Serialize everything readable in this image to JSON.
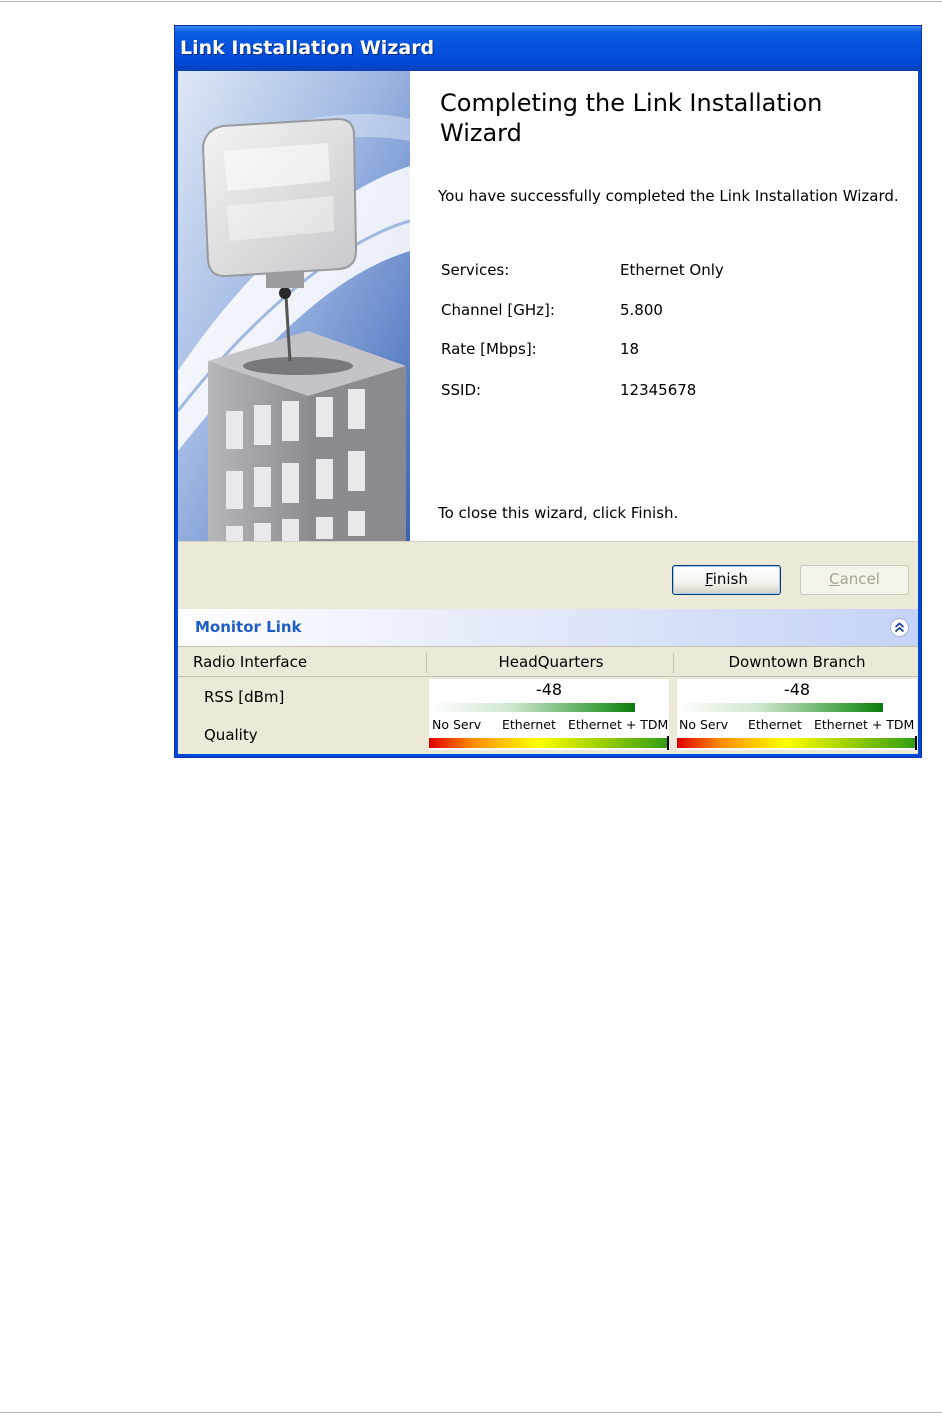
{
  "window": {
    "title": "Link Installation Wizard"
  },
  "content": {
    "heading": "Completing the Link Installation Wizard",
    "message": "You have successfully completed the Link Installation  Wizard.",
    "summary": [
      {
        "label": "Services:",
        "value": "Ethernet Only"
      },
      {
        "label": "Channel [GHz]:",
        "value": "5.800"
      },
      {
        "label": "Rate [Mbps]:",
        "value": "18"
      },
      {
        "label": "SSID:",
        "value": "12345678"
      }
    ],
    "closing": "To close this wizard, click Finish."
  },
  "buttons": {
    "finish_accel": "F",
    "finish_rest": "inish",
    "cancel_accel": "C",
    "cancel_rest": "ancel"
  },
  "monitor": {
    "title": "Monitor Link",
    "columns": [
      "Radio Interface",
      "HeadQuarters",
      "Downtown Branch"
    ],
    "rows": [
      "RSS [dBm]",
      "Quality"
    ],
    "quality_labels": [
      "No Serv",
      "Ethernet",
      "Ethernet + TDM"
    ],
    "sites": [
      {
        "rss": "-48",
        "rss_level": 0.86,
        "quality_level": 1.0
      },
      {
        "rss": "-48",
        "rss_level": 0.86,
        "quality_level": 1.0
      }
    ]
  },
  "icons": {
    "collapse": "double-chevron-up-icon"
  }
}
